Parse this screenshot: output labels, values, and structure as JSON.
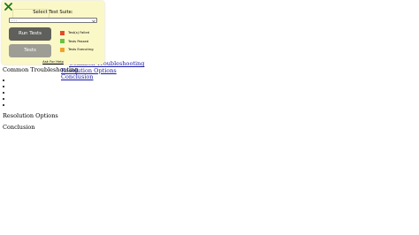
{
  "panel": {
    "title": "Select Test Suite:",
    "select_value": "- - -",
    "buttons": {
      "run": "Run Tests",
      "tests": "Tests"
    },
    "legend": [
      {
        "label": "Test(s) Failed",
        "color": "#e24a2e"
      },
      {
        "label": "Tests Passed",
        "color": "#69c33e"
      },
      {
        "label": "Tests Executing",
        "color": "#f0a32a"
      }
    ],
    "help_link": "Ask For Help",
    "close_icon": "close-icon",
    "accent_color": "#1f7a1f"
  },
  "page": {
    "nav_links": [
      "Common Troubleshooting",
      "Resolution Options",
      "Conclusion"
    ],
    "sections": [
      "Common Troubleshooting",
      "Resolution Options",
      "Conclusion"
    ],
    "bullet_count": 5
  }
}
